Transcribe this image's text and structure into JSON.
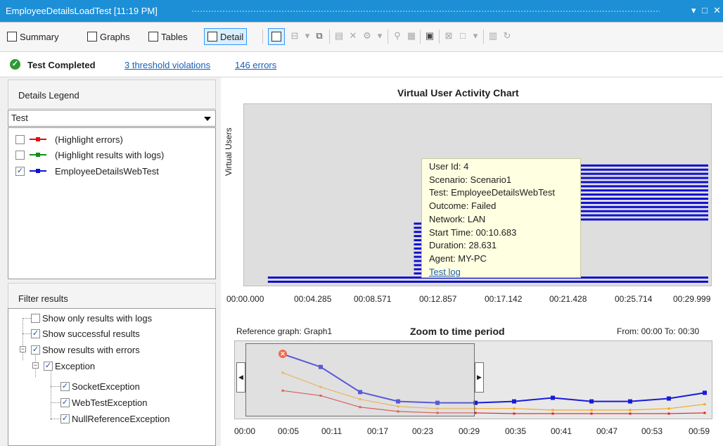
{
  "window": {
    "title": "EmployeeDetailsLoadTest [11:19 PM]"
  },
  "toolbar": {
    "summary": "Summary",
    "graphs": "Graphs",
    "tables": "Tables",
    "detail": "Detail"
  },
  "status": {
    "state": "Test Completed",
    "violations": "3 threshold violations",
    "errors": "146 errors"
  },
  "legend": {
    "header": "Details Legend",
    "selected": "Test",
    "items": [
      {
        "label": "(Highlight errors)",
        "color": "#e01010",
        "checked": false
      },
      {
        "label": "(Highlight results with logs)",
        "color": "#109010",
        "checked": false
      },
      {
        "label": "EmployeeDetailsWebTest",
        "color": "#1010d0",
        "checked": true
      }
    ]
  },
  "filter": {
    "header": "Filter results",
    "items": [
      {
        "label": "Show only results with logs",
        "checked": false
      },
      {
        "label": "Show successful results",
        "checked": true
      },
      {
        "label": "Show results with errors",
        "checked": true
      },
      {
        "label": "Exception",
        "checked": true
      },
      {
        "label": "SocketException",
        "checked": true
      },
      {
        "label": "WebTestException",
        "checked": true
      },
      {
        "label": "NullReferenceException",
        "checked": true
      }
    ]
  },
  "activity": {
    "title": "Virtual User Activity Chart",
    "ylabel": "Virtual Users",
    "xticks": [
      "00:00.000",
      "00:04.285",
      "00:08.571",
      "00:12.857",
      "00:17.142",
      "00:21.428",
      "00:25.714",
      "00:29.999"
    ]
  },
  "tooltip": {
    "lines": [
      "User Id: 4",
      "Scenario: Scenario1",
      "Test: EmployeeDetailsWebTest",
      "Outcome: Failed",
      "Network: LAN",
      "Start Time: 00:10.683",
      "Duration: 28.631",
      "Agent: MY-PC"
    ],
    "link": "Test log"
  },
  "zoom": {
    "reference": "Reference graph: Graph1",
    "title": "Zoom to time period",
    "range": "From: 00:00  To: 00:30",
    "xticks": [
      "00:00",
      "00:05",
      "00:11",
      "00:17",
      "00:23",
      "00:29",
      "00:35",
      "00:41",
      "00:47",
      "00:53",
      "00:59"
    ]
  },
  "chart_data": [
    {
      "type": "bar",
      "title": "Virtual User Activity Chart",
      "ylabel": "Virtual Users",
      "xlabel": "",
      "xlim": [
        0,
        29.999
      ],
      "note": "Horizontal timeline bars, one per virtual user (start, end in seconds)",
      "series": [
        {
          "name": "EmployeeDetailsWebTest",
          "color": "#1010d0",
          "users": [
            {
              "start": 1.1,
              "end": 29.999
            },
            {
              "start": 1.1,
              "end": 29.999
            },
            {
              "start": 10.683,
              "end": 13.2
            },
            {
              "start": 10.683,
              "end": 13.2
            },
            {
              "start": 10.683,
              "end": 13.2
            },
            {
              "start": 10.683,
              "end": 13.2
            },
            {
              "start": 10.683,
              "end": 13.2
            },
            {
              "start": 10.683,
              "end": 13.2
            },
            {
              "start": 10.683,
              "end": 13.2
            },
            {
              "start": 10.683,
              "end": 13.2
            },
            {
              "start": 10.683,
              "end": 13.2
            },
            {
              "start": 10.683,
              "end": 13.2
            },
            {
              "start": 10.683,
              "end": 13.2
            },
            {
              "start": 10.683,
              "end": 13.2
            },
            {
              "start": 10.683,
              "end": 13.2
            },
            {
              "start": 21.4,
              "end": 29.999
            },
            {
              "start": 21.4,
              "end": 29.999
            },
            {
              "start": 21.4,
              "end": 29.999
            },
            {
              "start": 21.4,
              "end": 29.999
            },
            {
              "start": 21.4,
              "end": 29.999
            },
            {
              "start": 21.4,
              "end": 29.999
            },
            {
              "start": 21.4,
              "end": 29.999
            },
            {
              "start": 21.4,
              "end": 29.999
            },
            {
              "start": 21.4,
              "end": 29.999
            },
            {
              "start": 21.4,
              "end": 29.999
            },
            {
              "start": 21.4,
              "end": 29.999
            },
            {
              "start": 21.4,
              "end": 29.999
            },
            {
              "start": 21.4,
              "end": 29.999
            },
            {
              "start": 21.4,
              "end": 29.999
            }
          ]
        }
      ]
    },
    {
      "type": "line",
      "title": "Zoom to time period",
      "xlim": [
        0,
        59
      ],
      "ylim": [
        0,
        10
      ],
      "x": [
        5,
        10,
        14,
        20,
        25,
        29,
        35,
        41,
        47,
        53,
        59
      ],
      "series": [
        {
          "name": "blue",
          "color": "#1a1adc",
          "values": [
            8.6,
            6.8,
            3.3,
            2.0,
            1.8,
            1.8,
            2.0,
            2.5,
            2.0,
            2.0,
            2.4,
            3.2
          ]
        },
        {
          "name": "orange",
          "color": "#f5a623",
          "values": [
            6.0,
            4.0,
            2.3,
            1.3,
            1.0,
            1.0,
            1.0,
            0.8,
            0.8,
            0.8,
            1.0,
            1.6
          ]
        },
        {
          "name": "red",
          "color": "#e02020",
          "values": [
            3.5,
            2.8,
            1.2,
            0.6,
            0.4,
            0.4,
            0.3,
            0.3,
            0.3,
            0.3,
            0.3,
            0.4
          ]
        }
      ]
    }
  ]
}
